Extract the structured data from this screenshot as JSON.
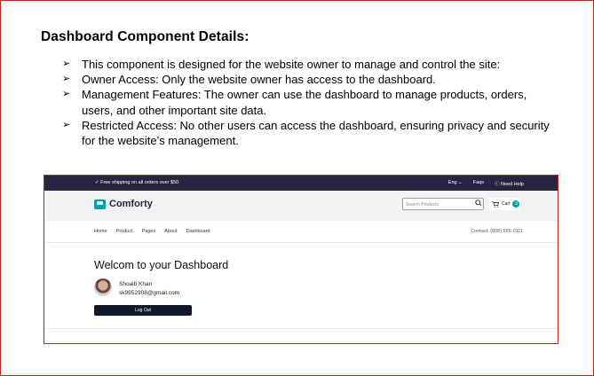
{
  "document": {
    "title": "Dashboard Component Details:",
    "bullets": [
      "This component is designed for the website owner to manage and control the site:",
      "Owner Access: Only the website owner has access to the dashboard.",
      "Management Features: The owner can use the dashboard to manage products, orders, users, and other important site data.",
      "Restricted Access: No other users can access the dashboard, ensuring privacy and security for the website’s management."
    ],
    "bullet_glyph": "➢"
  },
  "screenshot": {
    "topbar": {
      "promo": "✓ Free shipping on all orders over $50",
      "language": "Eng ⌄",
      "faqs": "Faqs",
      "help": "ⓘ Need Help"
    },
    "header": {
      "logo_text": "Comforty",
      "search_placeholder": "Search Products",
      "cart_label": "Cart",
      "cart_count": "2"
    },
    "nav": {
      "links": [
        "Home",
        "Product",
        "Pages",
        "About",
        "Dashboard"
      ],
      "contact": "Contact: (808) 555-0111"
    },
    "dashboard": {
      "welcome": "Welcom to your Dashboard",
      "user_name": "Shoaib Khan",
      "user_email": "sk9952908@gmail.com",
      "logout_label": "Log Out"
    },
    "colors": {
      "topbar": "#272343",
      "brand": "#029fae",
      "button": "#111827",
      "frame": "#d21f1f"
    }
  }
}
